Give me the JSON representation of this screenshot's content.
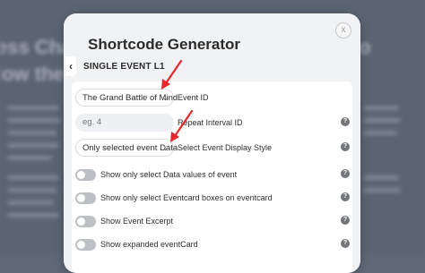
{
  "background": {
    "headings": [
      "ess Cha",
      "low the"
    ],
    "right_headings": [
      "o"
    ]
  },
  "modal": {
    "title": "Shortcode Generator",
    "close_glyph": "x",
    "back_glyph": "‹",
    "section_title": "SINGLE EVENT L1"
  },
  "fields": {
    "event_select": {
      "value": "The Grand Battle of Mind",
      "label": "Event ID",
      "chevron": "⌄"
    },
    "repeat_interval": {
      "placeholder": "eg. 4",
      "label": "Repeat Interval ID",
      "help": "?"
    },
    "display_style": {
      "value": "Only selected event Data",
      "label": "Select Event Display Style",
      "chevron": "⌄",
      "help": "?"
    }
  },
  "toggles": [
    {
      "label": "Show only select Data values of event",
      "help": "?",
      "state": "off"
    },
    {
      "label": "Show only select Eventcard boxes on eventcard",
      "help": "?",
      "state": "off"
    },
    {
      "label": "Show Event Excerpt",
      "help": "?",
      "state": "off"
    },
    {
      "label": "Show expanded eventCard",
      "help": "?",
      "state": "off"
    }
  ],
  "colors": {
    "annotation_arrow": "#e8262b",
    "toggle_off": "#bcc0c5",
    "help_icon": "#727579"
  }
}
